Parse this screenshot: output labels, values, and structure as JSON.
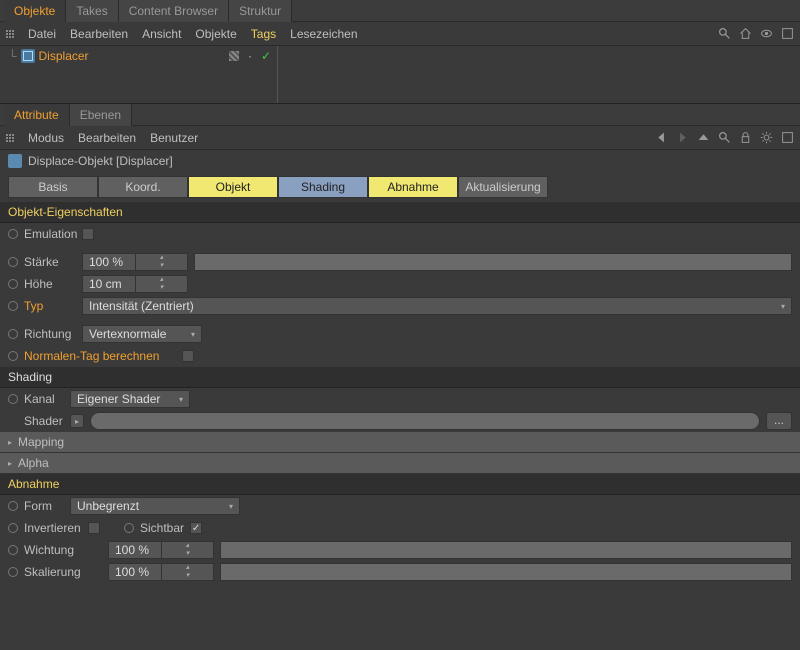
{
  "topTabs": {
    "objekte": "Objekte",
    "takes": "Takes",
    "contentBrowser": "Content Browser",
    "struktur": "Struktur"
  },
  "objMenu": {
    "datei": "Datei",
    "bearbeiten": "Bearbeiten",
    "ansicht": "Ansicht",
    "objekte": "Objekte",
    "tags": "Tags",
    "lesezeichen": "Lesezeichen"
  },
  "object": {
    "name": "Displacer"
  },
  "attrTabs": {
    "attribute": "Attribute",
    "ebenen": "Ebenen"
  },
  "attrMenu": {
    "modus": "Modus",
    "bearbeiten": "Bearbeiten",
    "benutzer": "Benutzer"
  },
  "attrTitle": "Displace-Objekt [Displacer]",
  "subTabs": {
    "basis": "Basis",
    "koord": "Koord.",
    "objekt": "Objekt",
    "shading": "Shading",
    "abnahme": "Abnahme",
    "aktualisierung": "Aktualisierung"
  },
  "sections": {
    "objektEigenschaften": "Objekt-Eigenschaften",
    "shading": "Shading",
    "abnahme": "Abnahme"
  },
  "props": {
    "emulation": "Emulation",
    "staerke": {
      "label": "Stärke",
      "value": "100 %"
    },
    "hoehe": {
      "label": "Höhe",
      "value": "10 cm"
    },
    "typ": {
      "label": "Typ",
      "value": "Intensität (Zentriert)"
    },
    "richtung": {
      "label": "Richtung",
      "value": "Vertexnormale"
    },
    "normalenTag": "Normalen-Tag berechnen",
    "kanal": {
      "label": "Kanal",
      "value": "Eigener Shader"
    },
    "shader": "Shader",
    "mapping": "Mapping",
    "alpha": "Alpha",
    "form": {
      "label": "Form",
      "value": "Unbegrenzt"
    },
    "invertieren": "Invertieren",
    "sichtbar": "Sichtbar",
    "wichtung": {
      "label": "Wichtung",
      "value": "100 %"
    },
    "skalierung": {
      "label": "Skalierung",
      "value": "100 %"
    },
    "dots": "..."
  }
}
